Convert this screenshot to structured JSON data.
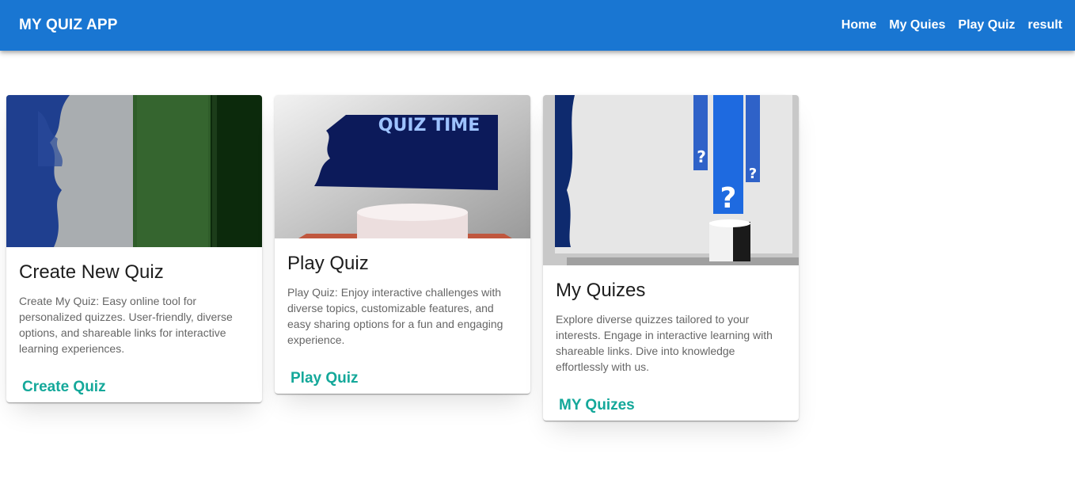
{
  "appbar": {
    "title": "MY QUIZ APP",
    "nav": [
      "Home",
      "My Quies",
      "Play Quiz",
      "result"
    ]
  },
  "cards": [
    {
      "title": "Create New Quiz",
      "text": "Create My Quiz: Easy online tool for personalized quizzes. User-friendly, diverse options, and shareable links for interactive learning experiences.",
      "action": "Create Quiz"
    },
    {
      "title": "Play Quiz",
      "text": "Play Quiz: Enjoy interactive challenges with diverse topics, customizable features, and easy sharing options for a fun and engaging experience.",
      "action": "Play Quiz",
      "image_text": "QUIZ TIME"
    },
    {
      "title": "My Quizes",
      "text": "Explore diverse quizzes tailored to your interests. Engage in interactive learning with shareable links. Dive into knowledge effortlessly with us.",
      "action": "MY Quizes"
    }
  ],
  "colors": {
    "appbar": "#1976d2",
    "action": "#14a89a"
  }
}
